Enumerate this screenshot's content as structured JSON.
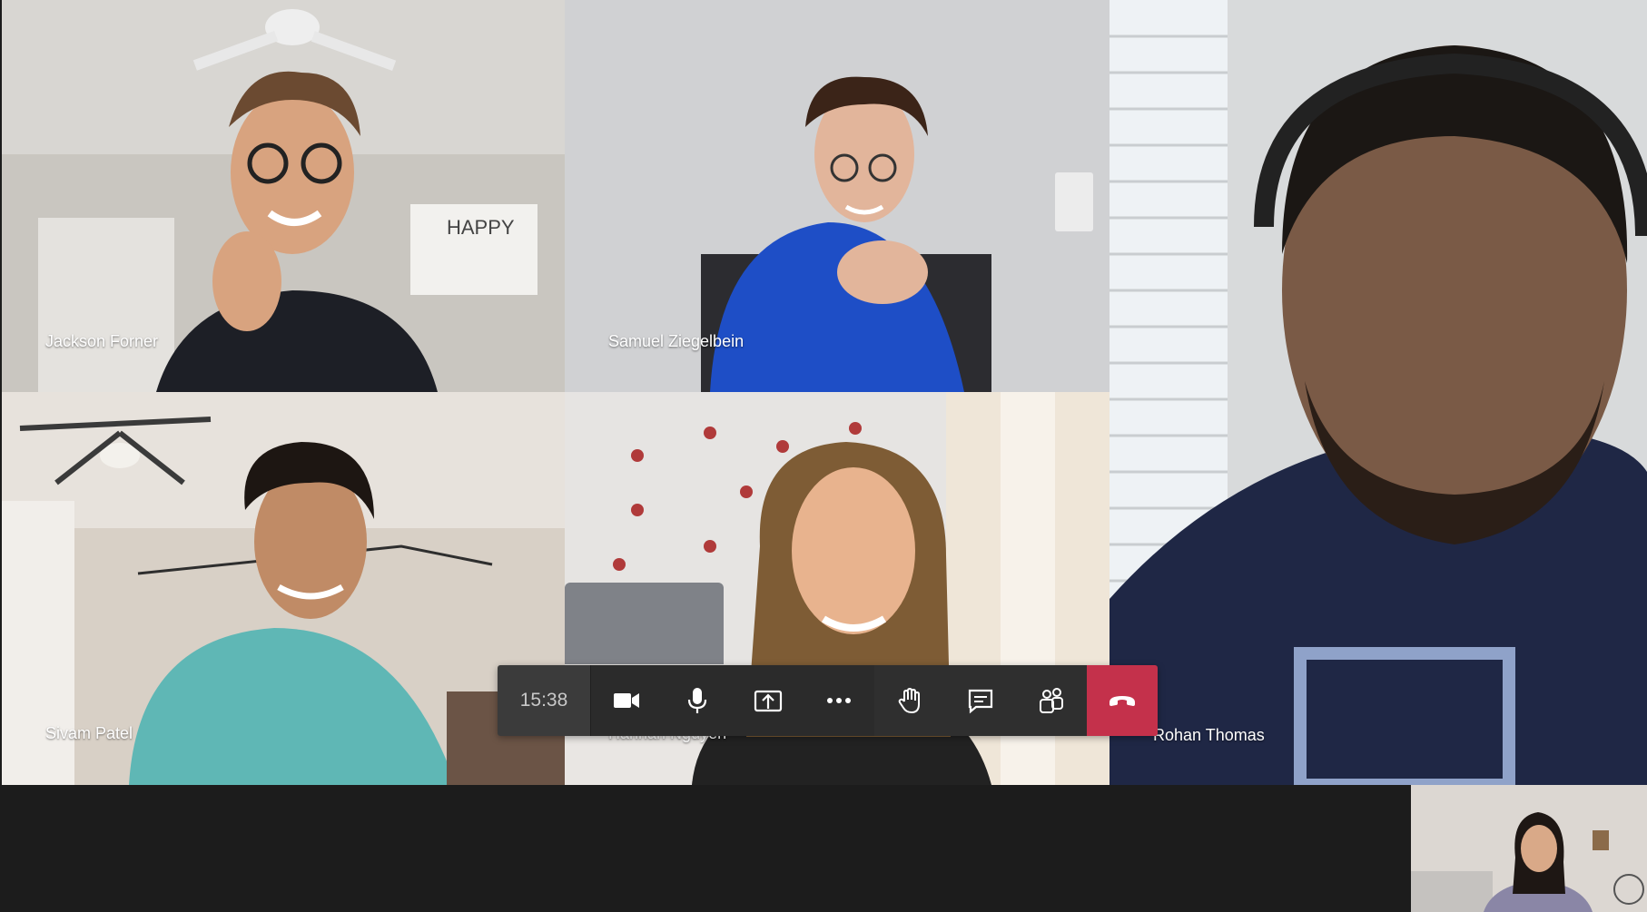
{
  "call": {
    "timer": "15:38",
    "participants": [
      {
        "name": "Jackson Forner"
      },
      {
        "name": "Samuel Ziegelbein"
      },
      {
        "name": "Rohan Thomas"
      },
      {
        "name": "Sivam Patel"
      },
      {
        "name": "Hannah Nguyen"
      }
    ]
  },
  "controls": {
    "items": [
      {
        "icon": "video-camera-icon"
      },
      {
        "icon": "microphone-icon"
      },
      {
        "icon": "share-screen-icon"
      },
      {
        "icon": "more-options-icon"
      },
      {
        "icon": "raise-hand-icon"
      },
      {
        "icon": "chat-icon"
      },
      {
        "icon": "participants-icon"
      },
      {
        "icon": "hang-up-icon"
      }
    ],
    "hangup_color": "#c4314b"
  }
}
